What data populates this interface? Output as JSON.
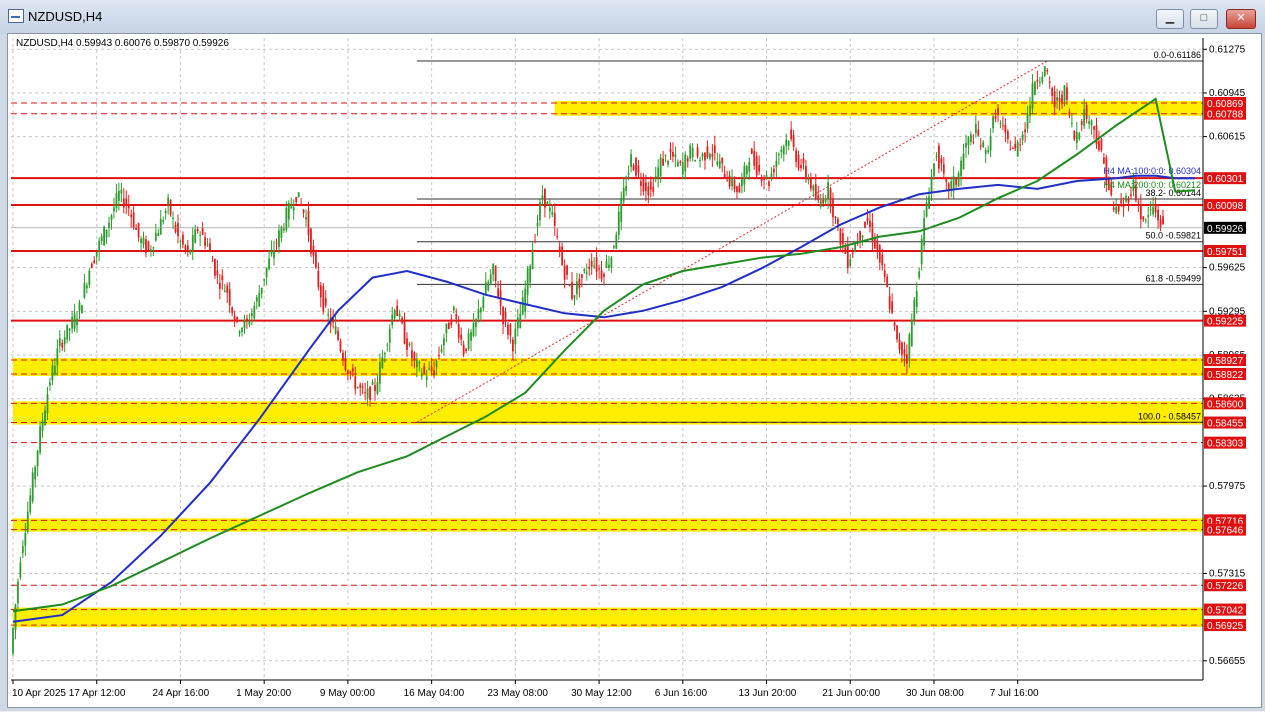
{
  "window": {
    "title": "NZDUSD,H4",
    "minimize_glyph": "▁",
    "maximize_glyph": "□",
    "close_glyph": "✕"
  },
  "chart_data": {
    "type": "line",
    "symbol_header": "NZDUSD,H4  0.59943 0.60076 0.59870 0.59926",
    "ylim": [
      0.5651,
      0.6136
    ],
    "y_ticks": [
      "0.61275",
      "0.60945",
      "0.60615",
      "0.59625",
      "0.59295",
      "0.58965",
      "0.58635",
      "0.57975",
      "0.57315",
      "0.56655"
    ],
    "x_ticks": [
      "10 Apr 2025",
      "17 Apr 12:00",
      "24 Apr 16:00",
      "1 May 20:00",
      "9 May 00:00",
      "16 May 04:00",
      "23 May 08:00",
      "30 May 12:00",
      "6 Jun 16:00",
      "13 Jun 20:00",
      "21 Jun 00:00",
      "30 Jun 08:00",
      "7 Jul 16:00"
    ],
    "x_tick_index": [
      0,
      34,
      68,
      102,
      136,
      170,
      204,
      238,
      272,
      306,
      340,
      374,
      408
    ],
    "current_price": "0.59926",
    "current_value": 0.59926,
    "colors": {
      "up": "#2e9b2e",
      "down": "#e02020",
      "ma100": "#1f2fc8",
      "ma200": "#1e8c1e",
      "level": "#e01010",
      "zone": "#ffee00",
      "fib": "#303030",
      "grid": "#c8c8c8"
    },
    "ma_labels": {
      "ma100": "H4 MA:100:0:0: 0.60304",
      "ma200": "H4 MA:200:0:0: 0.60212"
    },
    "fib_levels": [
      {
        "label": "0.0-0.61186",
        "value": 0.61186
      },
      {
        "label": "38.2- 0.60144",
        "value": 0.60144
      },
      {
        "label": "50.0 -0.59821",
        "value": 0.59821
      },
      {
        "label": "61.8 -0.59499",
        "value": 0.59499
      },
      {
        "label": "100.0 - 0.58457",
        "value": 0.58457
      }
    ],
    "solid_levels": [
      {
        "label": "0.60301",
        "value": 0.60301
      },
      {
        "label": "0.60098",
        "value": 0.60098
      },
      {
        "label": "0.59751",
        "value": 0.59751
      },
      {
        "label": "0.59225",
        "value": 0.59225
      }
    ],
    "dashed_levels": [
      {
        "label": "0.60869",
        "value": 0.60869
      },
      {
        "label": "0.60788",
        "value": 0.60788
      },
      {
        "label": "0.58927",
        "value": 0.58927
      },
      {
        "label": "0.58822",
        "value": 0.58822
      },
      {
        "label": "0.58600",
        "value": 0.586
      },
      {
        "label": "0.58455",
        "value": 0.58455
      },
      {
        "label": "0.58303",
        "value": 0.58303
      },
      {
        "label": "0.57716",
        "value": 0.57716
      },
      {
        "label": "0.57646",
        "value": 0.57646
      },
      {
        "label": "0.57226",
        "value": 0.57226
      },
      {
        "label": "0.57042",
        "value": 0.57042
      },
      {
        "label": "0.56925",
        "value": 0.56925
      }
    ],
    "zones": [
      {
        "from": 0.60788,
        "to": 0.60869,
        "start_index": 220
      },
      {
        "from": 0.58822,
        "to": 0.58927,
        "start_index": 0
      },
      {
        "from": 0.58455,
        "to": 0.586,
        "start_index": 0
      },
      {
        "from": 0.57646,
        "to": 0.57716,
        "start_index": 0
      },
      {
        "from": 0.56925,
        "to": 0.57042,
        "start_index": 0
      }
    ],
    "close_path": [
      [
        0,
        0.5671
      ],
      [
        4,
        0.5745
      ],
      [
        8,
        0.579
      ],
      [
        12,
        0.5838
      ],
      [
        16,
        0.5878
      ],
      [
        20,
        0.5905
      ],
      [
        24,
        0.5917
      ],
      [
        28,
        0.5932
      ],
      [
        32,
        0.5962
      ],
      [
        36,
        0.598
      ],
      [
        40,
        0.5998
      ],
      [
        44,
        0.6018
      ],
      [
        48,
        0.6008
      ],
      [
        52,
        0.5985
      ],
      [
        56,
        0.5975
      ],
      [
        60,
        0.5992
      ],
      [
        64,
        0.601
      ],
      [
        68,
        0.5985
      ],
      [
        72,
        0.5972
      ],
      [
        76,
        0.5992
      ],
      [
        80,
        0.598
      ],
      [
        84,
        0.5955
      ],
      [
        88,
        0.5945
      ],
      [
        92,
        0.5918
      ],
      [
        96,
        0.592
      ],
      [
        100,
        0.5938
      ],
      [
        104,
        0.5962
      ],
      [
        108,
        0.5982
      ],
      [
        112,
        0.6002
      ],
      [
        116,
        0.6018
      ],
      [
        120,
        0.6
      ],
      [
        124,
        0.5958
      ],
      [
        128,
        0.5928
      ],
      [
        132,
        0.5915
      ],
      [
        136,
        0.589
      ],
      [
        140,
        0.5875
      ],
      [
        144,
        0.5865
      ],
      [
        148,
        0.5872
      ],
      [
        152,
        0.5902
      ],
      [
        156,
        0.5935
      ],
      [
        160,
        0.591
      ],
      [
        164,
        0.589
      ],
      [
        168,
        0.5882
      ],
      [
        172,
        0.5885
      ],
      [
        176,
        0.591
      ],
      [
        180,
        0.593
      ],
      [
        184,
        0.59
      ],
      [
        188,
        0.5915
      ],
      [
        192,
        0.5942
      ],
      [
        196,
        0.596
      ],
      [
        200,
        0.5925
      ],
      [
        204,
        0.5905
      ],
      [
        208,
        0.5935
      ],
      [
        212,
        0.5978
      ],
      [
        216,
        0.6018
      ],
      [
        220,
        0.6
      ],
      [
        224,
        0.5965
      ],
      [
        228,
        0.5942
      ],
      [
        232,
        0.5955
      ],
      [
        236,
        0.5968
      ],
      [
        240,
        0.5958
      ],
      [
        244,
        0.5972
      ],
      [
        248,
        0.601
      ],
      [
        252,
        0.6045
      ],
      [
        256,
        0.6028
      ],
      [
        260,
        0.602
      ],
      [
        264,
        0.6042
      ],
      [
        268,
        0.6048
      ],
      [
        272,
        0.6038
      ],
      [
        276,
        0.605
      ],
      [
        280,
        0.6045
      ],
      [
        284,
        0.6052
      ],
      [
        288,
        0.604
      ],
      [
        292,
        0.6028
      ],
      [
        296,
        0.602
      ],
      [
        300,
        0.6048
      ],
      [
        304,
        0.6035
      ],
      [
        308,
        0.6028
      ],
      [
        312,
        0.605
      ],
      [
        316,
        0.6062
      ],
      [
        320,
        0.6042
      ],
      [
        324,
        0.603
      ],
      [
        328,
        0.601
      ],
      [
        332,
        0.6022
      ],
      [
        336,
        0.599
      ],
      [
        340,
        0.5968
      ],
      [
        344,
        0.5985
      ],
      [
        348,
        0.5998
      ],
      [
        352,
        0.5975
      ],
      [
        356,
        0.5945
      ],
      [
        360,
        0.5905
      ],
      [
        364,
        0.5895
      ],
      [
        368,
        0.595
      ],
      [
        372,
        0.6012
      ],
      [
        376,
        0.605
      ],
      [
        380,
        0.6022
      ],
      [
        384,
        0.6028
      ],
      [
        388,
        0.6055
      ],
      [
        392,
        0.6065
      ],
      [
        396,
        0.6048
      ],
      [
        400,
        0.608
      ],
      [
        404,
        0.606
      ],
      [
        408,
        0.605
      ],
      [
        412,
        0.607
      ],
      [
        416,
        0.6105
      ],
      [
        420,
        0.6112
      ],
      [
        424,
        0.6085
      ],
      [
        428,
        0.6095
      ],
      [
        432,
        0.606
      ],
      [
        436,
        0.608
      ],
      [
        440,
        0.6068
      ],
      [
        444,
        0.604
      ],
      [
        448,
        0.6005
      ],
      [
        452,
        0.601
      ],
      [
        456,
        0.6025
      ],
      [
        460,
        0.5995
      ],
      [
        464,
        0.6008
      ],
      [
        468,
        0.5992
      ]
    ],
    "ma100_path": [
      [
        0,
        0.5695
      ],
      [
        20,
        0.57
      ],
      [
        40,
        0.5725
      ],
      [
        60,
        0.576
      ],
      [
        80,
        0.58
      ],
      [
        100,
        0.5848
      ],
      [
        120,
        0.59
      ],
      [
        132,
        0.593
      ],
      [
        146,
        0.5955
      ],
      [
        160,
        0.596
      ],
      [
        176,
        0.5952
      ],
      [
        192,
        0.5942
      ],
      [
        208,
        0.5935
      ],
      [
        224,
        0.5928
      ],
      [
        240,
        0.5925
      ],
      [
        256,
        0.593
      ],
      [
        272,
        0.5938
      ],
      [
        288,
        0.5948
      ],
      [
        304,
        0.5962
      ],
      [
        320,
        0.5978
      ],
      [
        336,
        0.5995
      ],
      [
        352,
        0.6008
      ],
      [
        368,
        0.6018
      ],
      [
        384,
        0.6022
      ],
      [
        400,
        0.6025
      ],
      [
        416,
        0.6022
      ],
      [
        432,
        0.6028
      ],
      [
        448,
        0.603
      ],
      [
        456,
        0.6032
      ],
      [
        464,
        0.6032
      ],
      [
        472,
        0.603
      ],
      [
        480,
        0.603
      ]
    ],
    "ma200_path": [
      [
        0,
        0.5703
      ],
      [
        20,
        0.5708
      ],
      [
        40,
        0.5722
      ],
      [
        60,
        0.574
      ],
      [
        80,
        0.5758
      ],
      [
        100,
        0.5775
      ],
      [
        120,
        0.5792
      ],
      [
        140,
        0.5808
      ],
      [
        160,
        0.582
      ],
      [
        176,
        0.5835
      ],
      [
        192,
        0.585
      ],
      [
        208,
        0.5868
      ],
      [
        224,
        0.59
      ],
      [
        240,
        0.593
      ],
      [
        256,
        0.595
      ],
      [
        272,
        0.596
      ],
      [
        288,
        0.5965
      ],
      [
        304,
        0.597
      ],
      [
        320,
        0.5973
      ],
      [
        336,
        0.5978
      ],
      [
        352,
        0.5986
      ],
      [
        368,
        0.599
      ],
      [
        384,
        0.6
      ],
      [
        400,
        0.6015
      ],
      [
        416,
        0.6028
      ],
      [
        432,
        0.6048
      ],
      [
        448,
        0.607
      ],
      [
        464,
        0.609
      ],
      [
        472,
        0.602
      ],
      [
        480,
        0.6021
      ]
    ],
    "fib_swing": [
      [
        164,
        0.58457
      ],
      [
        420,
        0.61186
      ]
    ]
  }
}
